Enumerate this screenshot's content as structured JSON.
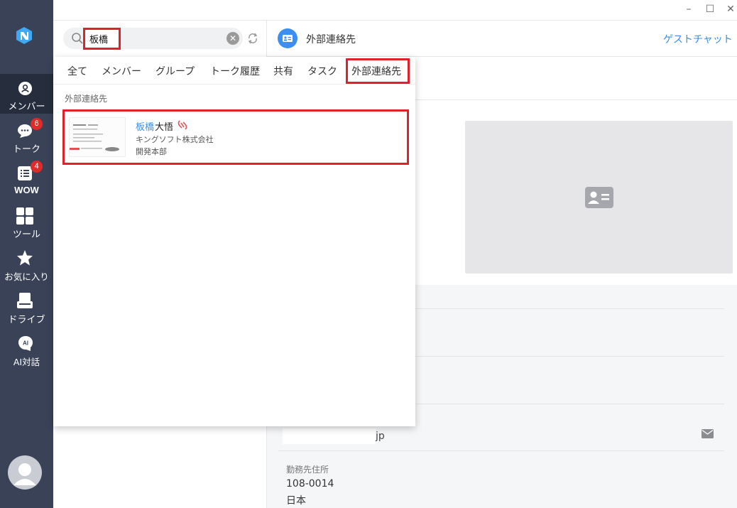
{
  "app": {
    "nav": [
      {
        "label": "メンバー",
        "icon": "person-icon"
      },
      {
        "label": "トーク",
        "icon": "chat-icon",
        "badge": "6"
      },
      {
        "label": "WOW",
        "icon": "list-icon",
        "badge": "4"
      },
      {
        "label": "ツール",
        "icon": "grid-icon"
      },
      {
        "label": "お気に入り",
        "icon": "star-icon"
      },
      {
        "label": "ドライブ",
        "icon": "drive-icon"
      },
      {
        "label": "AI対話",
        "icon": "ai-icon",
        "icon_text": "AI"
      }
    ]
  },
  "window": {
    "minimize": "–",
    "maximize": "☐",
    "close": "✕"
  },
  "search": {
    "query": "板橋"
  },
  "dropdown": {
    "tabs": [
      "全て",
      "メンバー",
      "グループ",
      "トーク履歴",
      "共有",
      "タスク",
      "外部連絡先"
    ],
    "active_tab": "外部連絡先",
    "section_label": "外部連絡先",
    "result": {
      "name_highlight": "板橋",
      "name_rest": "大悟",
      "company": "キングソフト株式会社",
      "department": "開発本部"
    }
  },
  "right_panel": {
    "title": "外部連絡先",
    "guest_chat": "ゲストチャット",
    "email_suffix": "jp",
    "address_label": "勤務先住所",
    "zip": "108-0014",
    "country": "日本"
  },
  "colors": {
    "sidebar": "#394257",
    "sidebar_active": "#262d3d",
    "accent": "#3a8fe6",
    "highlight_box": "#e0202a",
    "badge": "#e02b2b"
  }
}
